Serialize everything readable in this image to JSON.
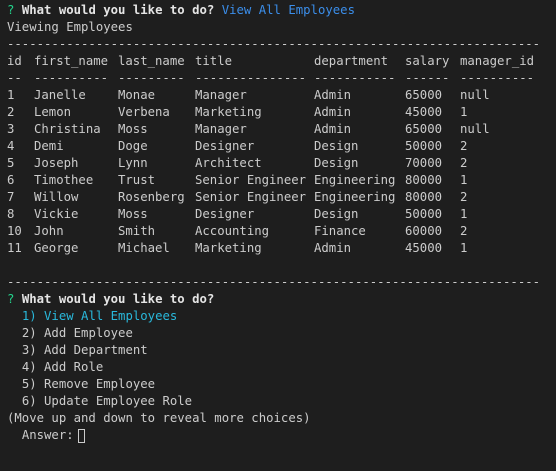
{
  "prompt1": {
    "marker": "?",
    "question": "What would you like to do?",
    "answer": "View All Employees"
  },
  "viewing_label": "Viewing Employees",
  "divider": "------------------------------------------------------------------------",
  "table": {
    "headers": [
      "id",
      "first_name",
      "last_name",
      "title",
      "department",
      "salary",
      "manager_id"
    ],
    "underlines": [
      "--",
      "----------",
      "---------",
      "---------------",
      "-----------",
      "------",
      "----------"
    ],
    "rows": [
      [
        "1",
        "Janelle",
        "Monae",
        "Manager",
        "Admin",
        "65000",
        "null"
      ],
      [
        "2",
        "Lemon",
        "Verbena",
        "Marketing",
        "Admin",
        "45000",
        "1"
      ],
      [
        "3",
        "Christina",
        "Moss",
        "Manager",
        "Admin",
        "65000",
        "null"
      ],
      [
        "4",
        "Demi",
        "Doge",
        "Designer",
        "Design",
        "50000",
        "2"
      ],
      [
        "5",
        "Joseph",
        "Lynn",
        "Architect",
        "Design",
        "70000",
        "2"
      ],
      [
        "6",
        "Timothee",
        "Trust",
        "Senior Engineer",
        "Engineering",
        "80000",
        "1"
      ],
      [
        "7",
        "Willow",
        "Rosenberg",
        "Senior Engineer",
        "Engineering",
        "80000",
        "2"
      ],
      [
        "8",
        "Vickie",
        "Moss",
        "Designer",
        "Design",
        "50000",
        "1"
      ],
      [
        "10",
        "John",
        "Smith",
        "Accounting",
        "Finance",
        "60000",
        "2"
      ],
      [
        "11",
        "George",
        "Michael",
        "Marketing",
        "Admin",
        "45000",
        "1"
      ]
    ]
  },
  "prompt2": {
    "marker": "?",
    "question": "What would you like to do?",
    "choices": [
      "1) View All Employees",
      "2) Add Employee",
      "3) Add Department",
      "4) Add Role",
      "5) Remove Employee",
      "6) Update Employee Role"
    ],
    "selected_index": 0,
    "hint": "(Move up and down to reveal more choices)",
    "answer_label": "Answer:"
  },
  "colors": {
    "background": "#1e1e1e",
    "text": "#cccccc",
    "marker": "#23d18b",
    "answer": "#3b8eea",
    "selected_choice": "#29b8db"
  }
}
